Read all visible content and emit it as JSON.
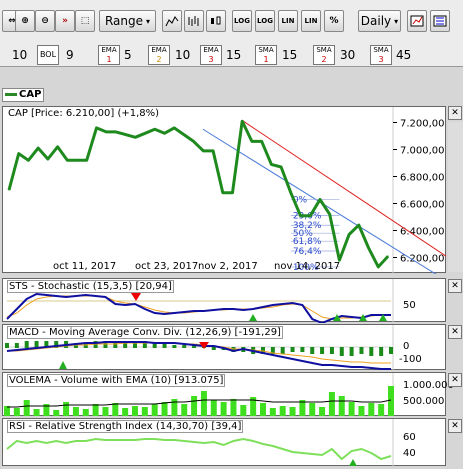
{
  "toolbar": {
    "range_label": "Range",
    "interval_label": "Daily",
    "chart_types": [
      "line-chart-icon",
      "bar-chart-icon",
      "candle-chart-icon"
    ],
    "log_buttons": [
      "LOG",
      "LOG",
      "LIN",
      "LIN"
    ],
    "pct_label": "%"
  },
  "indicators": {
    "first_value": "10",
    "bol_label": "BOL",
    "bol_value": "9",
    "ema": [
      {
        "label": "EMA",
        "sub": "1",
        "value": "5"
      },
      {
        "label": "EMA",
        "sub": "2",
        "value": "10"
      },
      {
        "label": "EMA",
        "sub": "3",
        "value": "15"
      }
    ],
    "sma": [
      {
        "label": "SMA",
        "sub": "1",
        "value": "15"
      },
      {
        "label": "SMA",
        "sub": "2",
        "value": "30"
      },
      {
        "label": "SMA",
        "sub": "3",
        "value": "45"
      }
    ]
  },
  "legend": {
    "label": "CAP"
  },
  "main_chart": {
    "title": "CAP [Price: 6.210,00] (+1,8%)",
    "y_ticks": [
      "7.200,00",
      "7.000,00",
      "6.800,00",
      "6.600,00",
      "6.400,00",
      "6.200,00"
    ],
    "x_ticks": [
      "oct 11, 2017",
      "oct 23, 2017",
      "nov 2, 2017",
      "nov 14, 2017"
    ],
    "fib_labels": [
      "0%",
      "23,6%",
      "38,2%",
      "50%",
      "61,8%",
      "76,4%",
      "100%"
    ]
  },
  "sto": {
    "title": "STS - Stochastic (15,3,5) [20,94]",
    "y_ticks": [
      "50"
    ]
  },
  "macd": {
    "title": "MACD - Moving Average Conv. Div. (12,26,9) [-191,29]",
    "y_ticks": [
      "0",
      "-100"
    ]
  },
  "volema": {
    "title": "VOLEMA - Volume with EMA (10) [913.075]",
    "y_ticks": [
      "1.000.000",
      "500.000"
    ]
  },
  "rsi": {
    "title": "RSI - Relative Strength Index (14,30,70) [39,4]",
    "y_ticks": [
      "60",
      "40"
    ]
  },
  "chart_data": {
    "type": "line",
    "title": "CAP [Price: 6.210,00] (+1,8%)",
    "series": [
      {
        "name": "CAP",
        "values": [
          6700,
          6970,
          6920,
          7010,
          6930,
          7020,
          6920,
          6920,
          6920,
          7160,
          7130,
          7130,
          7110,
          7090,
          7120,
          7150,
          7120,
          7160,
          7110,
          7060,
          6990,
          6990,
          6680,
          6680,
          7210,
          7060,
          7060,
          6890,
          6870,
          6680,
          6510,
          6510,
          6630,
          6520,
          6180,
          6370,
          6440,
          6270,
          6130,
          6210
        ]
      }
    ],
    "ylim": [
      6100,
      7300
    ],
    "y_ticks": [
      7200,
      7000,
      6800,
      6600,
      6400,
      6200
    ]
  }
}
